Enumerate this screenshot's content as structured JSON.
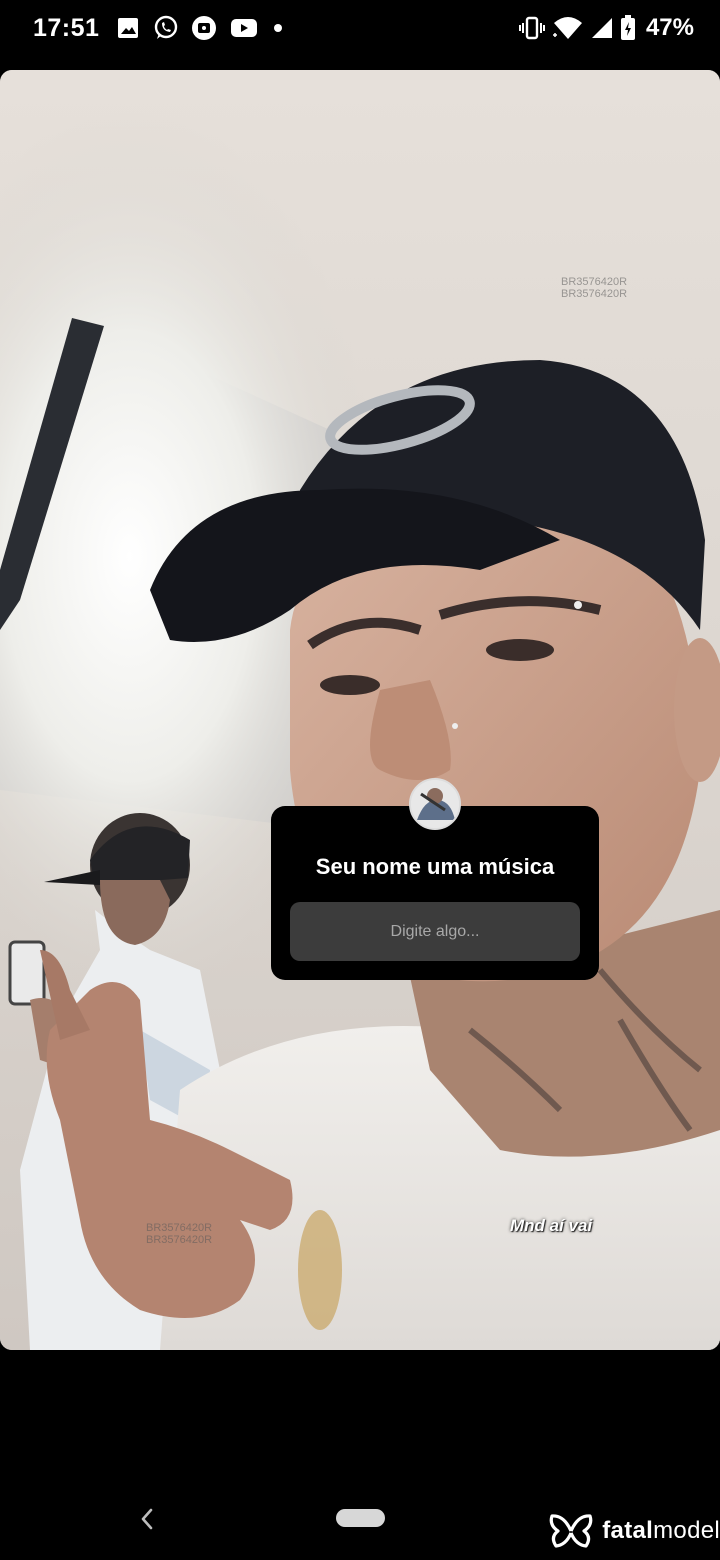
{
  "status_bar": {
    "time": "17:51",
    "notification_icons": [
      "gallery-icon",
      "whatsapp-icon",
      "app-notification-icon",
      "youtube-icon",
      "more-dot-icon"
    ],
    "battery_percent": "47%",
    "system_icons": [
      "vibrate-icon",
      "wifi-icon",
      "signal-icon",
      "battery-icon"
    ]
  },
  "story": {
    "watermark_code": "BR3576420R",
    "question": {
      "title": "Seu nome uma música",
      "placeholder": "Digite algo..."
    },
    "caption": "Mnd aí vai"
  },
  "nav_bar": {
    "back_icon": "chevron-left-icon",
    "home_pill": "home-pill"
  },
  "brand": {
    "part1": "fatal",
    "part2": "model"
  },
  "colors": {
    "background": "#000000",
    "sticker": "#000000",
    "input_field": "#3c3c3c",
    "placeholder_text": "#a8a8a8"
  }
}
